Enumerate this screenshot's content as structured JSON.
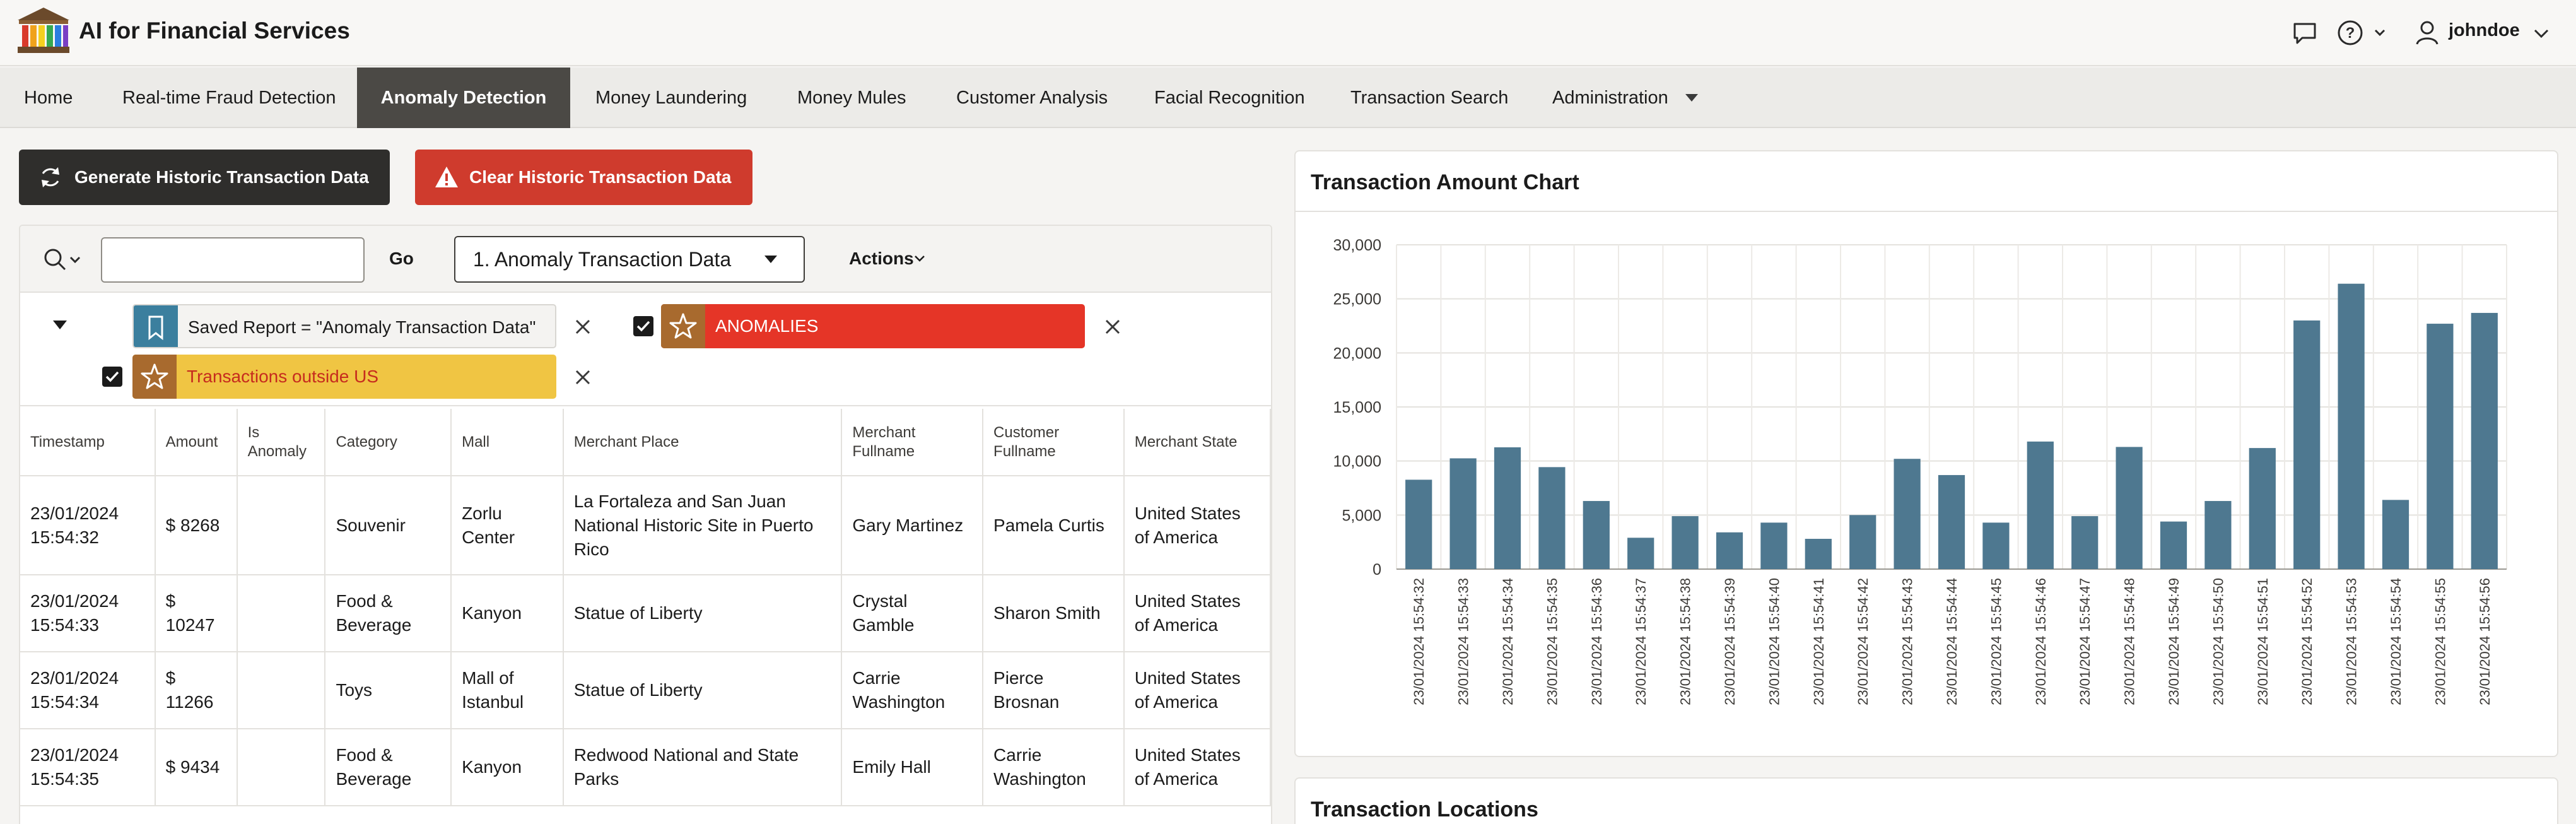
{
  "app": {
    "title": "AI for Financial Services"
  },
  "header": {
    "user_name": "johndoe"
  },
  "nav": [
    {
      "label": "Home",
      "active": false
    },
    {
      "label": "Real-time Fraud Detection",
      "active": false
    },
    {
      "label": "Anomaly Detection",
      "active": true
    },
    {
      "label": "Money Laundering",
      "active": false
    },
    {
      "label": "Money Mules",
      "active": false
    },
    {
      "label": "Customer Analysis",
      "active": false
    },
    {
      "label": "Facial Recognition",
      "active": false
    },
    {
      "label": "Transaction Search",
      "active": false
    },
    {
      "label": "Administration",
      "active": false
    }
  ],
  "buttons": {
    "generate": "Generate Historic Transaction Data",
    "clear": "Clear Historic Transaction Data"
  },
  "report": {
    "search_value": "",
    "go_label": "Go",
    "selected_report": "1. Anomaly Transaction Data",
    "actions_label": "Actions",
    "filters": {
      "saved": "Saved Report = \"Anomaly Transaction Data\"",
      "anomalies": "ANOMALIES",
      "outside_us": "Transactions outside US"
    },
    "columns": [
      "Timestamp",
      "Amount",
      "Is Anomaly",
      "Category",
      "Mall",
      "Merchant Place",
      "Merchant Fullname",
      "Customer Fullname",
      "Merchant State"
    ],
    "rows": [
      {
        "timestamp": "23/01/2024 15:54:32",
        "amount": "$ 8268",
        "is_anomaly": "",
        "category": "Souvenir",
        "mall": "Zorlu Center",
        "merchant_place": "La Fortaleza and San Juan National Historic Site in Puerto Rico",
        "merchant_fullname": "Gary Martinez",
        "customer_fullname": "Pamela Curtis",
        "merchant_state": "United States of America"
      },
      {
        "timestamp": "23/01/2024 15:54:33",
        "amount": "$ 10247",
        "is_anomaly": "",
        "category": "Food & Beverage",
        "mall": "Kanyon",
        "merchant_place": "Statue of Liberty",
        "merchant_fullname": "Crystal Gamble",
        "customer_fullname": "Sharon Smith",
        "merchant_state": "United States of America"
      },
      {
        "timestamp": "23/01/2024 15:54:34",
        "amount": "$ 11266",
        "is_anomaly": "",
        "category": "Toys",
        "mall": "Mall of Istanbul",
        "merchant_place": "Statue of Liberty",
        "merchant_fullname": "Carrie Washington",
        "customer_fullname": "Pierce Brosnan",
        "merchant_state": "United States of America"
      },
      {
        "timestamp": "23/01/2024 15:54:35",
        "amount": "$ 9434",
        "is_anomaly": "",
        "category": "Food & Beverage",
        "mall": "Kanyon",
        "merchant_place": "Redwood National and State Parks",
        "merchant_fullname": "Emily Hall",
        "customer_fullname": "Carrie Washington",
        "merchant_state": "United States of America"
      }
    ]
  },
  "chart_panel": {
    "title": "Transaction Amount Chart"
  },
  "locations_panel": {
    "title": "Transaction Locations"
  },
  "colors": {
    "bar": "#4e7890",
    "active_nav": "#4b4945",
    "danger": "#cf3b2d",
    "anomaly_chip": "#e53527",
    "outside_us_chip": "#f0c543"
  },
  "chart_data": {
    "type": "bar",
    "title": "Transaction Amount Chart",
    "categories": [
      "23/01/2024 15:54:32",
      "23/01/2024 15:54:33",
      "23/01/2024 15:54:34",
      "23/01/2024 15:54:35",
      "23/01/2024 15:54:36",
      "23/01/2024 15:54:37",
      "23/01/2024 15:54:38",
      "23/01/2024 15:54:39",
      "23/01/2024 15:54:40",
      "23/01/2024 15:54:41",
      "23/01/2024 15:54:42",
      "23/01/2024 15:54:43",
      "23/01/2024 15:54:44",
      "23/01/2024 15:54:45",
      "23/01/2024 15:54:46",
      "23/01/2024 15:54:47",
      "23/01/2024 15:54:48",
      "23/01/2024 15:54:49",
      "23/01/2024 15:54:50",
      "23/01/2024 15:54:51",
      "23/01/2024 15:54:52",
      "23/01/2024 15:54:53",
      "23/01/2024 15:54:54",
      "23/01/2024 15:54:55",
      "23/01/2024 15:54:56"
    ],
    "values": [
      8268,
      10247,
      11266,
      9434,
      6300,
      2900,
      4900,
      3400,
      4300,
      2800,
      5000,
      10200,
      8700,
      4300,
      11800,
      4900,
      11300,
      4400,
      6300,
      11200,
      23000,
      26400,
      6400,
      22700,
      23700
    ],
    "yticks": [
      "0",
      "5,000",
      "10,000",
      "15,000",
      "20,000",
      "25,000",
      "30,000"
    ],
    "ylim": [
      0,
      30000
    ],
    "grid": true
  }
}
